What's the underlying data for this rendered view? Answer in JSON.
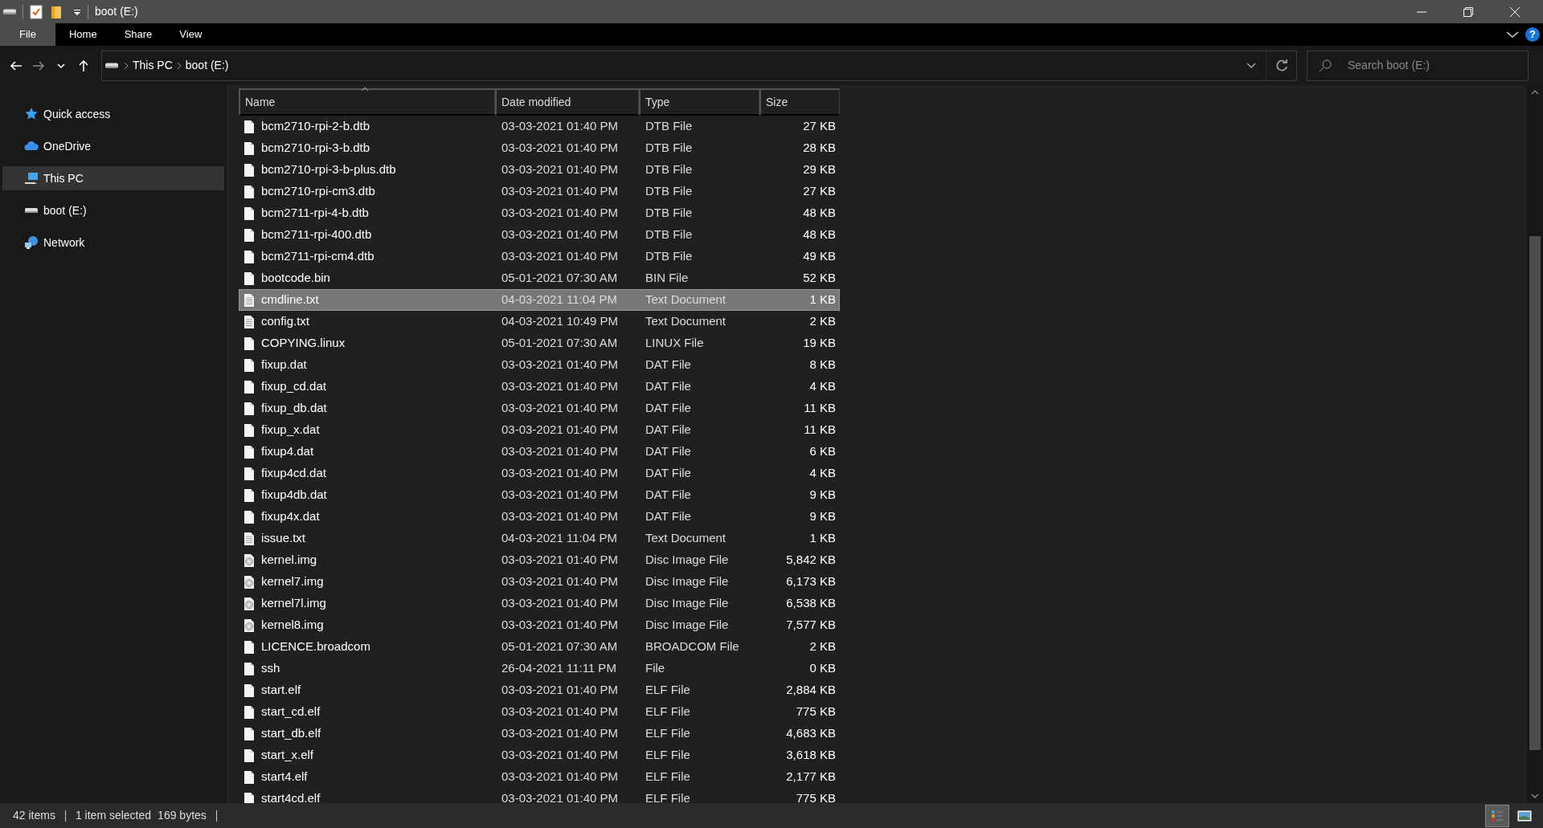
{
  "window": {
    "title": "boot (E:)"
  },
  "ribbon_tabs": [
    {
      "label": "File",
      "kind": "menu"
    },
    {
      "label": "Home",
      "kind": "tab"
    },
    {
      "label": "Share",
      "kind": "tab"
    },
    {
      "label": "View",
      "kind": "tab"
    }
  ],
  "help_button": "?",
  "address": {
    "path": [
      "This PC",
      "boot (E:)"
    ]
  },
  "search": {
    "placeholder": "Search boot (E:)"
  },
  "nav_items": [
    {
      "label": "Quick access",
      "kind": "star",
      "selected": false
    },
    {
      "label": "OneDrive",
      "kind": "cloud",
      "selected": false
    },
    {
      "label": "This PC",
      "kind": "pc",
      "selected": true
    },
    {
      "label": "boot (E:)",
      "kind": "drive",
      "selected": false
    },
    {
      "label": "Network",
      "kind": "network",
      "selected": false
    }
  ],
  "columns": [
    "Name",
    "Date modified",
    "Type",
    "Size"
  ],
  "files": [
    {
      "name": "bcm2710-rpi-2-b.dtb",
      "date": "03-03-2021 01:40 PM",
      "type": "DTB File",
      "size": "27 KB",
      "kind": "blank",
      "selected": false
    },
    {
      "name": "bcm2710-rpi-3-b.dtb",
      "date": "03-03-2021 01:40 PM",
      "type": "DTB File",
      "size": "28 KB",
      "kind": "blank",
      "selected": false
    },
    {
      "name": "bcm2710-rpi-3-b-plus.dtb",
      "date": "03-03-2021 01:40 PM",
      "type": "DTB File",
      "size": "29 KB",
      "kind": "blank",
      "selected": false
    },
    {
      "name": "bcm2710-rpi-cm3.dtb",
      "date": "03-03-2021 01:40 PM",
      "type": "DTB File",
      "size": "27 KB",
      "kind": "blank",
      "selected": false
    },
    {
      "name": "bcm2711-rpi-4-b.dtb",
      "date": "03-03-2021 01:40 PM",
      "type": "DTB File",
      "size": "48 KB",
      "kind": "blank",
      "selected": false
    },
    {
      "name": "bcm2711-rpi-400.dtb",
      "date": "03-03-2021 01:40 PM",
      "type": "DTB File",
      "size": "48 KB",
      "kind": "blank",
      "selected": false
    },
    {
      "name": "bcm2711-rpi-cm4.dtb",
      "date": "03-03-2021 01:40 PM",
      "type": "DTB File",
      "size": "49 KB",
      "kind": "blank",
      "selected": false
    },
    {
      "name": "bootcode.bin",
      "date": "05-01-2021 07:30 AM",
      "type": "BIN File",
      "size": "52 KB",
      "kind": "blank",
      "selected": false
    },
    {
      "name": "cmdline.txt",
      "date": "04-03-2021 11:04 PM",
      "type": "Text Document",
      "size": "1 KB",
      "kind": "text",
      "selected": true
    },
    {
      "name": "config.txt",
      "date": "04-03-2021 10:49 PM",
      "type": "Text Document",
      "size": "2 KB",
      "kind": "text",
      "selected": false
    },
    {
      "name": "COPYING.linux",
      "date": "05-01-2021 07:30 AM",
      "type": "LINUX File",
      "size": "19 KB",
      "kind": "blank",
      "selected": false
    },
    {
      "name": "fixup.dat",
      "date": "03-03-2021 01:40 PM",
      "type": "DAT File",
      "size": "8 KB",
      "kind": "blank",
      "selected": false
    },
    {
      "name": "fixup_cd.dat",
      "date": "03-03-2021 01:40 PM",
      "type": "DAT File",
      "size": "4 KB",
      "kind": "blank",
      "selected": false
    },
    {
      "name": "fixup_db.dat",
      "date": "03-03-2021 01:40 PM",
      "type": "DAT File",
      "size": "11 KB",
      "kind": "blank",
      "selected": false
    },
    {
      "name": "fixup_x.dat",
      "date": "03-03-2021 01:40 PM",
      "type": "DAT File",
      "size": "11 KB",
      "kind": "blank",
      "selected": false
    },
    {
      "name": "fixup4.dat",
      "date": "03-03-2021 01:40 PM",
      "type": "DAT File",
      "size": "6 KB",
      "kind": "blank",
      "selected": false
    },
    {
      "name": "fixup4cd.dat",
      "date": "03-03-2021 01:40 PM",
      "type": "DAT File",
      "size": "4 KB",
      "kind": "blank",
      "selected": false
    },
    {
      "name": "fixup4db.dat",
      "date": "03-03-2021 01:40 PM",
      "type": "DAT File",
      "size": "9 KB",
      "kind": "blank",
      "selected": false
    },
    {
      "name": "fixup4x.dat",
      "date": "03-03-2021 01:40 PM",
      "type": "DAT File",
      "size": "9 KB",
      "kind": "blank",
      "selected": false
    },
    {
      "name": "issue.txt",
      "date": "04-03-2021 11:04 PM",
      "type": "Text Document",
      "size": "1 KB",
      "kind": "text",
      "selected": false
    },
    {
      "name": "kernel.img",
      "date": "03-03-2021 01:40 PM",
      "type": "Disc Image File",
      "size": "5,842 KB",
      "kind": "disc",
      "selected": false
    },
    {
      "name": "kernel7.img",
      "date": "03-03-2021 01:40 PM",
      "type": "Disc Image File",
      "size": "6,173 KB",
      "kind": "disc",
      "selected": false
    },
    {
      "name": "kernel7l.img",
      "date": "03-03-2021 01:40 PM",
      "type": "Disc Image File",
      "size": "6,538 KB",
      "kind": "disc",
      "selected": false
    },
    {
      "name": "kernel8.img",
      "date": "03-03-2021 01:40 PM",
      "type": "Disc Image File",
      "size": "7,577 KB",
      "kind": "disc",
      "selected": false
    },
    {
      "name": "LICENCE.broadcom",
      "date": "05-01-2021 07:30 AM",
      "type": "BROADCOM File",
      "size": "2 KB",
      "kind": "blank",
      "selected": false
    },
    {
      "name": "ssh",
      "date": "26-04-2021 11:11 PM",
      "type": "File",
      "size": "0 KB",
      "kind": "blank",
      "selected": false
    },
    {
      "name": "start.elf",
      "date": "03-03-2021 01:40 PM",
      "type": "ELF File",
      "size": "2,884 KB",
      "kind": "blank",
      "selected": false
    },
    {
      "name": "start_cd.elf",
      "date": "03-03-2021 01:40 PM",
      "type": "ELF File",
      "size": "775 KB",
      "kind": "blank",
      "selected": false
    },
    {
      "name": "start_db.elf",
      "date": "03-03-2021 01:40 PM",
      "type": "ELF File",
      "size": "4,683 KB",
      "kind": "blank",
      "selected": false
    },
    {
      "name": "start_x.elf",
      "date": "03-03-2021 01:40 PM",
      "type": "ELF File",
      "size": "3,618 KB",
      "kind": "blank",
      "selected": false
    },
    {
      "name": "start4.elf",
      "date": "03-03-2021 01:40 PM",
      "type": "ELF File",
      "size": "2,177 KB",
      "kind": "blank",
      "selected": false
    },
    {
      "name": "start4cd.elf",
      "date": "03-03-2021 01:40 PM",
      "type": "ELF File",
      "size": "775 KB",
      "kind": "blank",
      "selected": false
    }
  ],
  "status_bar": {
    "count": "42 items",
    "selection": "1 item selected",
    "size": "169 bytes"
  }
}
